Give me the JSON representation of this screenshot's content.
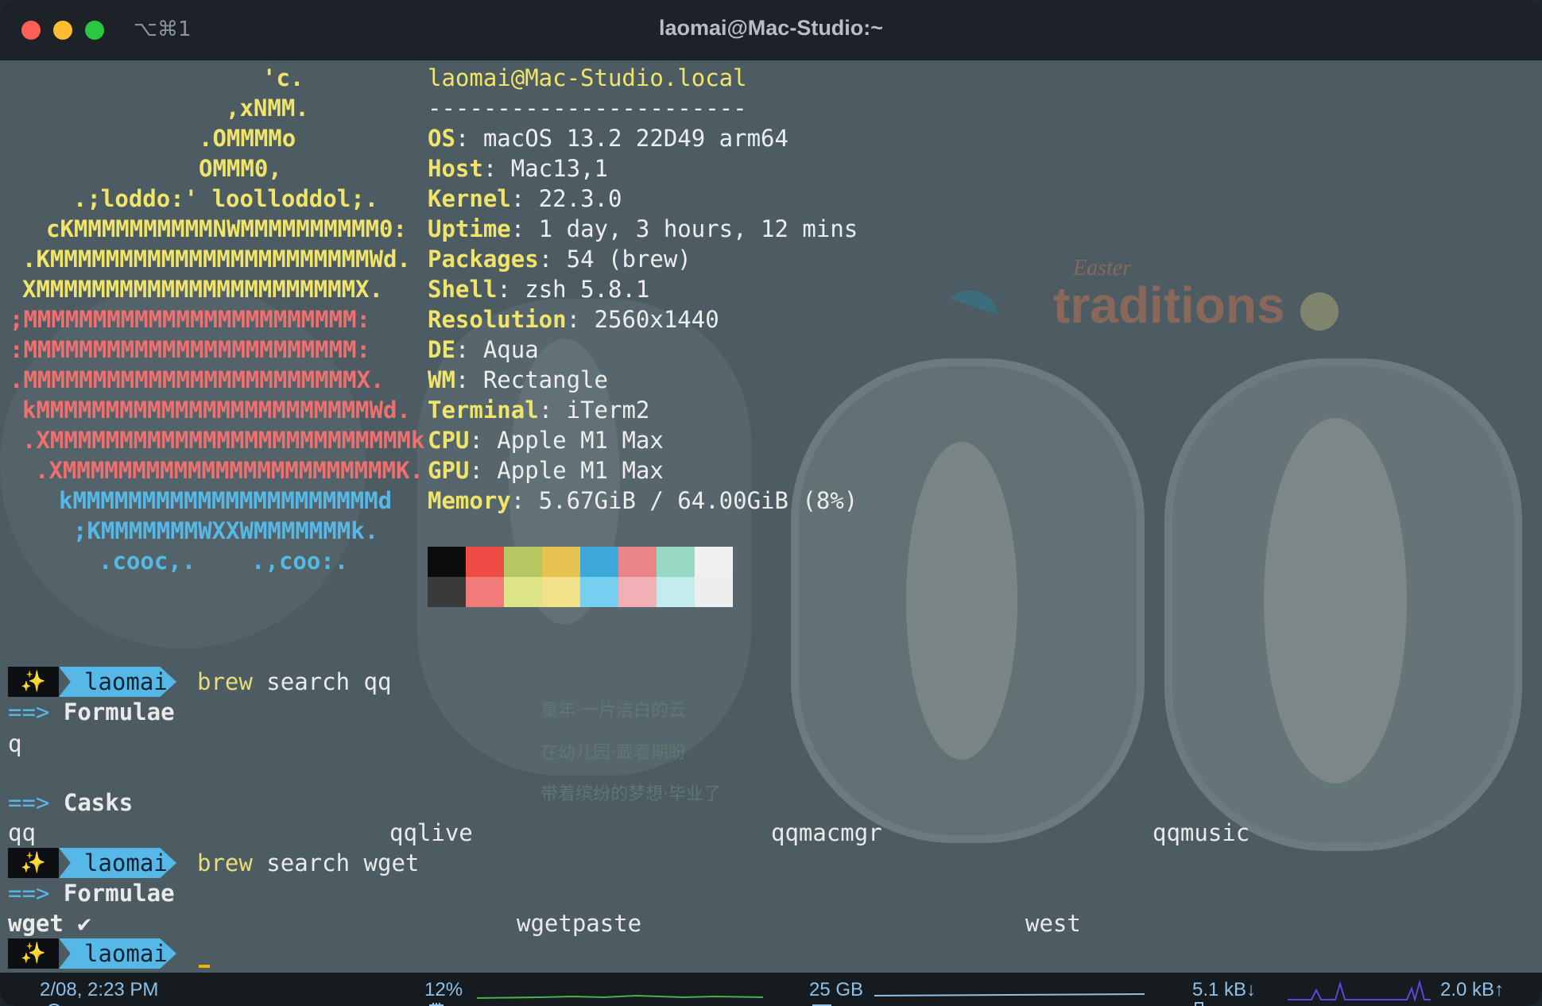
{
  "window": {
    "title": "laomai@Mac-Studio:~",
    "shortcut": "⌥⌘1"
  },
  "logo": [
    {
      "text": "'c.",
      "color": "#f1e46b"
    },
    {
      "text": ",xNMM.",
      "color": "#f1e46b"
    },
    {
      "text": ".OMMMMo",
      "color": "#f1e46b"
    },
    {
      "text": "OMMM0,",
      "color": "#f1e46b"
    },
    {
      "text": ".;loddo:' loolloddol;.",
      "color": "#f1e46b"
    },
    {
      "text": "cKMMMMMMMMMMNWMMMMMMMMMM0:",
      "color": "#f1e46b"
    },
    {
      "text": ".KMMMMMMMMMMMMMMMMMMMMMMMWd.",
      "color": "#f1e46b"
    },
    {
      "text": "XMMMMMMMMMMMMMMMMMMMMMMMX.",
      "color": "#f1e46b"
    },
    {
      "text": ";MMMMMMMMMMMMMMMMMMMMMMMM:",
      "color": "#f07070"
    },
    {
      "text": ":MMMMMMMMMMMMMMMMMMMMMMMM:",
      "color": "#f07070"
    },
    {
      "text": ".MMMMMMMMMMMMMMMMMMMMMMMMX.",
      "color": "#f07070"
    },
    {
      "text": "kMMMMMMMMMMMMMMMMMMMMMMMMWd.",
      "color": "#f07070"
    },
    {
      "text": ".XMMMMMMMMMMMMMMMMMMMMMMMMMMk",
      "color": "#f07070"
    },
    {
      "text": ".XMMMMMMMMMMMMMMMMMMMMMMMMK.",
      "color": "#f07070"
    },
    {
      "text": "kMMMMMMMMMMMMMMMMMMMMMMd",
      "color": "#56b8e6"
    },
    {
      "text": ";KMMMMMMMWXXWMMMMMMMk.",
      "color": "#56b8e6"
    },
    {
      "text": ".cooc,.    .,coo:.",
      "color": "#56b8e6"
    }
  ],
  "info": {
    "userhost": "laomai@Mac-Studio.local",
    "separator": "-----------------------",
    "rows": [
      {
        "key": "OS",
        "value": ": macOS 13.2 22D49 arm64"
      },
      {
        "key": "Host",
        "value": ": Mac13,1"
      },
      {
        "key": "Kernel",
        "value": ": 22.3.0"
      },
      {
        "key": "Uptime",
        "value": ": 1 day, 3 hours, 12 mins"
      },
      {
        "key": "Packages",
        "value": ": 54 (brew)"
      },
      {
        "key": "Shell",
        "value": ": zsh 5.8.1"
      },
      {
        "key": "Resolution",
        "value": ": 2560x1440"
      },
      {
        "key": "DE",
        "value": ": Aqua"
      },
      {
        "key": "WM",
        "value": ": Rectangle"
      },
      {
        "key": "Terminal",
        "value": ": iTerm2"
      },
      {
        "key": "CPU",
        "value": ": Apple M1 Max"
      },
      {
        "key": "GPU",
        "value": ": Apple M1 Max"
      },
      {
        "key": "Memory",
        "value": ": 5.67GiB / 64.00GiB (8%)"
      }
    ]
  },
  "palette": {
    "normal": [
      "#0c0c0c",
      "#ef4c46",
      "#b6c660",
      "#e6c250",
      "#3da8da",
      "#e98586",
      "#97d9c5",
      "#f0f0f0"
    ],
    "bright": [
      "#3a3a3a",
      "#f27a78",
      "#dde487",
      "#f1e28a",
      "#75cff0",
      "#f2b0b6",
      "#c5ecec",
      "#eeeeee"
    ]
  },
  "session": {
    "prompt_user": "laomai",
    "prompt_icon": "✨",
    "cmd1": {
      "program": "brew",
      "args": " search qq"
    },
    "formulae_header": "Formulae",
    "arrow": "==>",
    "formulae1": [
      "q"
    ],
    "casks_header": "Casks",
    "casks": [
      "qq",
      "qqlive",
      "qqmacmgr",
      "qqmusic"
    ],
    "cmd2": {
      "program": "brew",
      "args": " search wget"
    },
    "formulae2": [
      "wget ✔",
      "wgetpaste",
      "west"
    ]
  },
  "background_text": [
    "童年·一片洁白的云",
    "在幼儿园·載着期盼",
    "带着缤纷的梦想·毕业了"
  ],
  "background_brand": "traditions",
  "background_brand_small": "Easter",
  "statusbar": {
    "time": "2/08, 2:23 PM",
    "cpu": "12%",
    "memory": "25 GB",
    "net_down": "5.1 kB↓",
    "net_up": "2.0 kB↑",
    "colors": {
      "accent": "#8ec0e8"
    }
  }
}
